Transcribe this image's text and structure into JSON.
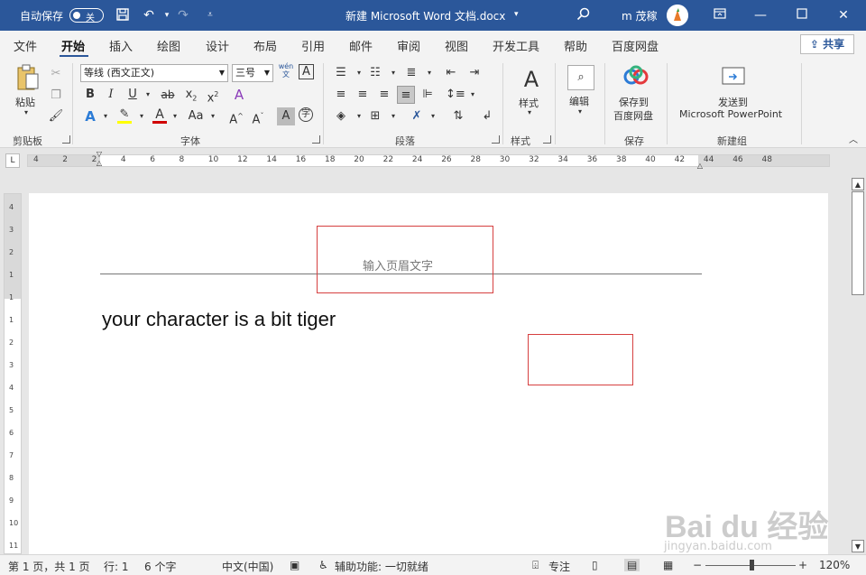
{
  "titlebar": {
    "autosave_label": "自动保存",
    "autosave_state": "关",
    "doc_title": "新建 Microsoft Word 文档.docx",
    "doc_title_caret": "▾",
    "user_name": "m 茂稼"
  },
  "tabs": [
    "文件",
    "开始",
    "插入",
    "绘图",
    "设计",
    "布局",
    "引用",
    "邮件",
    "审阅",
    "视图",
    "开发工具",
    "帮助",
    "百度网盘"
  ],
  "share_label": "共享",
  "ribbon": {
    "clipboard": {
      "paste_label": "粘贴",
      "group_label": "剪贴板"
    },
    "font": {
      "font_name": "等线 (西文正文)",
      "font_size": "三号",
      "wen_label": "wén",
      "wen_char": "文",
      "A_box": "A",
      "group_label": "字体"
    },
    "paragraph": {
      "group_label": "段落"
    },
    "styles": {
      "styles_label": "样式",
      "group_label": "样式"
    },
    "editing": {
      "edit_label": "编辑"
    },
    "save": {
      "save_line1": "保存到",
      "save_line2": "百度网盘",
      "group_label": "保存"
    },
    "newgroup": {
      "send_line1": "发送到",
      "send_line2": "Microsoft PowerPoint",
      "group_label": "新建组"
    }
  },
  "ruler_numbers": [
    "4",
    "2",
    "2",
    "4",
    "6",
    "8",
    "10",
    "12",
    "14",
    "16",
    "18",
    "20",
    "22",
    "24",
    "26",
    "28",
    "30",
    "32",
    "34",
    "36",
    "38",
    "40",
    "42",
    "44",
    "46",
    "48"
  ],
  "vruler_numbers": [
    "4",
    "3",
    "2",
    "1",
    "1",
    "1",
    "2",
    "3",
    "4",
    "5",
    "6",
    "7",
    "8",
    "9",
    "10",
    "11"
  ],
  "document": {
    "header_placeholder": "输入页眉文字",
    "body_text": "your character is a bit tiger"
  },
  "status": {
    "page": "第 1 页，共 1 页",
    "line": "行: 1",
    "chars": "6 个字",
    "language": "中文(中国)",
    "accessibility": "辅助功能: 一切就绪",
    "focus": "专注",
    "zoom": "120%"
  },
  "watermark": {
    "logo": "Bai du 经验",
    "url": "jingyan.baidu.com"
  },
  "colors": {
    "titlebar": "#2b579a",
    "ribbon": "#f3f3f3",
    "annotation_box": "#d64040",
    "font_color_red": "#d00000",
    "highlight_yellow": "#ffff00"
  }
}
